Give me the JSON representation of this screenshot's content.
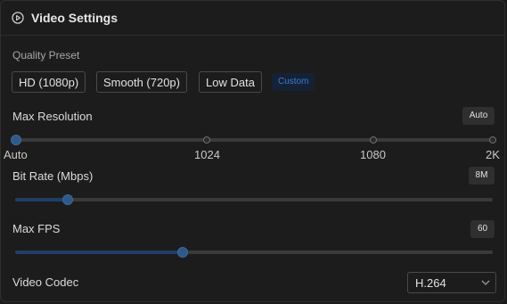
{
  "header": {
    "title": "Video Settings",
    "icon": "play-circle-icon"
  },
  "quality_preset": {
    "label": "Quality Preset",
    "options": [
      {
        "label": "HD (1080p)"
      },
      {
        "label": "Smooth (720p)"
      },
      {
        "label": "Low Data"
      },
      {
        "label": "Custom",
        "active": true
      }
    ]
  },
  "max_resolution": {
    "label": "Max Resolution",
    "value": "Auto",
    "ticks": [
      "Auto",
      "1024",
      "1080",
      "2K"
    ],
    "selected_index": 0
  },
  "bit_rate": {
    "label": "Bit Rate (Mbps)",
    "value": "8M",
    "fill_fraction": 0.11
  },
  "max_fps": {
    "label": "Max FPS",
    "value": "60",
    "fill_fraction": 0.35
  },
  "video_codec": {
    "label": "Video Codec",
    "selected": "H.264"
  },
  "colors": {
    "accent": "#2d5a8a",
    "accent_text": "#3b7bd4",
    "background": "#1c1c1c"
  }
}
